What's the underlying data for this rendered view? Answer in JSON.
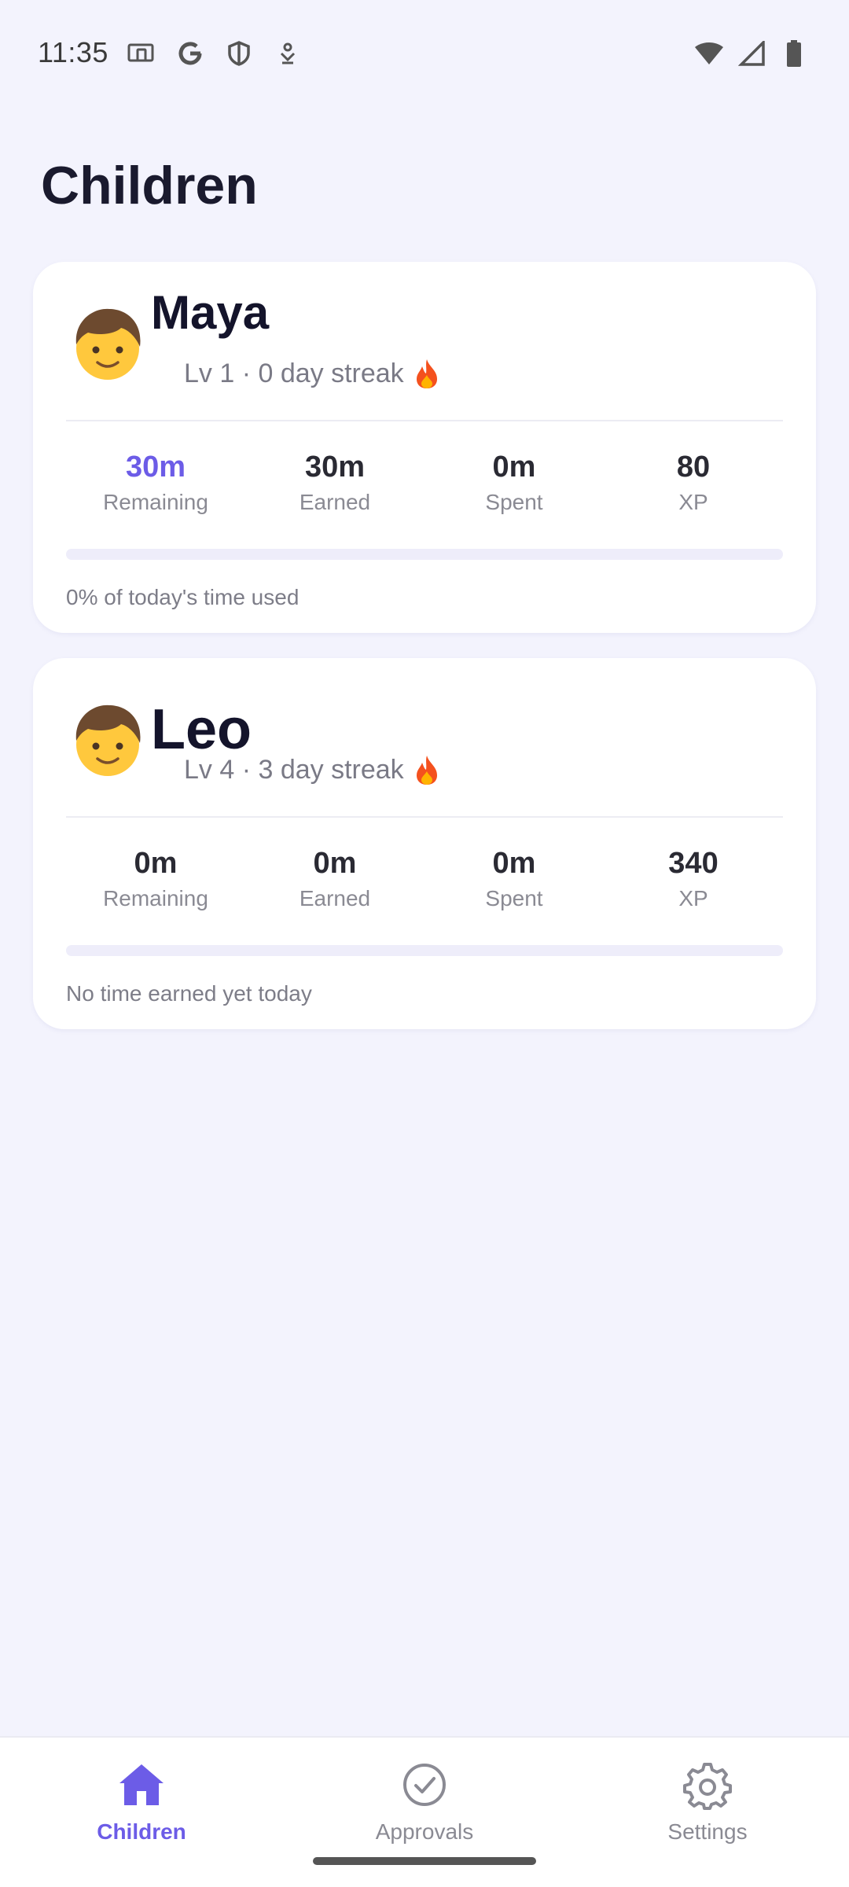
{
  "status_bar": {
    "time": "11:35",
    "left_icons": [
      "cast-icon",
      "google-icon",
      "shield-icon",
      "download-icon"
    ],
    "right_icons": [
      "wifi-icon",
      "signal-icon",
      "battery-icon"
    ]
  },
  "page": {
    "title": "Children"
  },
  "children": [
    {
      "avatar": "child-emoji-icon",
      "name": "Maya",
      "meta": "Lv 1 · 0 day streak",
      "stats": [
        {
          "value": "30m",
          "label": "Remaining"
        },
        {
          "value": "30m",
          "label": "Earned"
        },
        {
          "value": "0m",
          "label": "Spent"
        },
        {
          "value": "80",
          "label": "XP"
        }
      ],
      "progress_fraction": 0,
      "caption": "0% of today's time used"
    },
    {
      "avatar": "child-emoji-icon",
      "name": "Leo",
      "meta": "Lv 4 · 3 day streak",
      "stats": [
        {
          "value": "0m",
          "label": "Remaining"
        },
        {
          "value": "0m",
          "label": "Earned"
        },
        {
          "value": "0m",
          "label": "Spent"
        },
        {
          "value": "340",
          "label": "XP"
        }
      ],
      "progress_fraction": 0,
      "caption": "No time earned yet today"
    }
  ],
  "bottom_nav": {
    "items": [
      {
        "label": "Children",
        "icon": "home-icon",
        "active": true
      },
      {
        "label": "Approvals",
        "icon": "check-circle-icon",
        "active": false
      },
      {
        "label": "Settings",
        "icon": "gear-icon",
        "active": false
      }
    ]
  },
  "colors": {
    "accent": "#6c5ce7",
    "background": "#f3f3fd",
    "card": "#ffffff"
  }
}
